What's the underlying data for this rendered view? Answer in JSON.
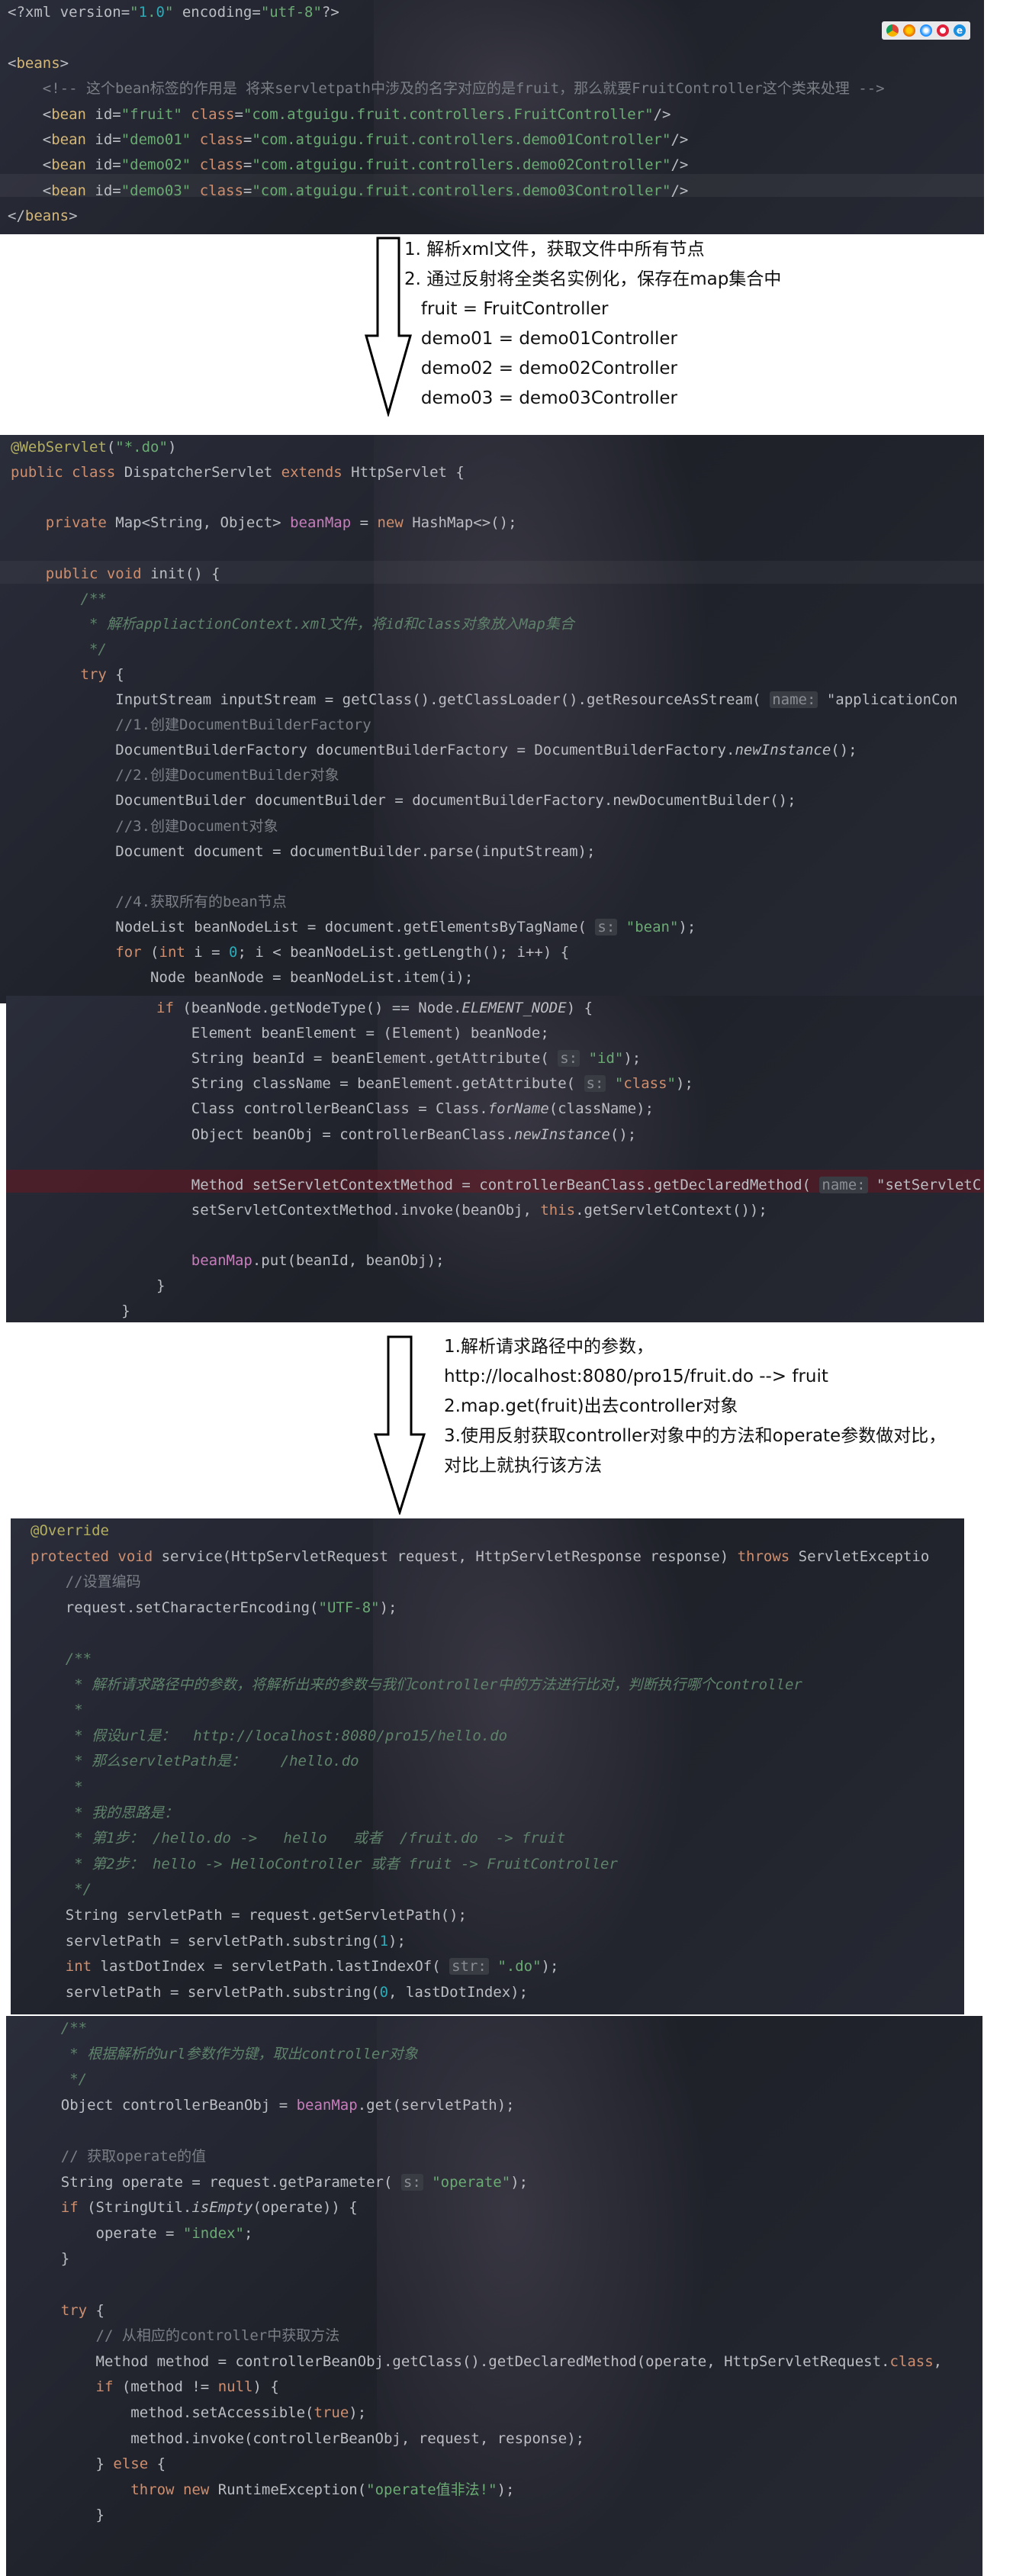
{
  "panel1": {
    "lines": [
      "<?xml version=\"1.0\" encoding=\"utf-8\"?>",
      "",
      "<beans>",
      "    <!-- 这个bean标签的作用是 将来servletpath中涉及的名字对应的是fruit，那么就要FruitController这个类来处理 -->",
      "    <bean id=\"fruit\" class=\"com.atguigu.fruit.controllers.FruitController\"/>",
      "    <bean id=\"demo01\" class=\"com.atguigu.fruit.controllers.demo01Controller\"/>",
      "    <bean id=\"demo02\" class=\"com.atguigu.fruit.controllers.demo02Controller\"/>",
      "    <bean id=\"demo03\" class=\"com.atguigu.fruit.controllers.demo03Controller\"/>",
      "</beans>"
    ]
  },
  "annotation1": [
    "1. 解析xml文件，获取文件中所有节点",
    "2. 通过反射将全类名实例化，保存在map集合中",
    "   fruit = FruitController",
    "   demo01 = demo01Controller",
    "   demo02 = demo02Controller",
    "   demo03 = demo03Controller"
  ],
  "panel2": {
    "lines": [
      "@WebServlet(\"*.do\")",
      "public class DispatcherServlet extends HttpServlet {",
      "",
      "    private Map<String, Object> beanMap = new HashMap<>();",
      "",
      "    public void init() {",
      "        /**",
      "         * 解析appliactionContext.xml文件，将id和class对象放入Map集合",
      "         */",
      "        try {",
      "            InputStream inputStream = getClass().getClassLoader().getResourceAsStream( name: \"applicationCon",
      "            //1.创建DocumentBuilderFactory",
      "            DocumentBuilderFactory documentBuilderFactory = DocumentBuilderFactory.newInstance();",
      "            //2.创建DocumentBuilder对象",
      "            DocumentBuilder documentBuilder = documentBuilderFactory.newDocumentBuilder();",
      "            //3.创建Document对象",
      "            Document document = documentBuilder.parse(inputStream);",
      "",
      "            //4.获取所有的bean节点",
      "            NodeList beanNodeList = document.getElementsByTagName( s: \"bean\");",
      "            for (int i = 0; i < beanNodeList.getLength(); i++) {",
      "                Node beanNode = beanNodeList.item(i);"
    ]
  },
  "panel3": {
    "lines": [
      "                if (beanNode.getNodeType() == Node.ELEMENT_NODE) {",
      "                    Element beanElement = (Element) beanNode;",
      "                    String beanId = beanElement.getAttribute( s: \"id\");",
      "                    String className = beanElement.getAttribute( s: \"class\");",
      "                    Class controllerBeanClass = Class.forName(className);",
      "                    Object beanObj = controllerBeanClass.newInstance();",
      "",
      "                    Method setServletContextMethod = controllerBeanClass.getDeclaredMethod( name: \"setServletC",
      "                    setServletContextMethod.invoke(beanObj, this.getServletContext());",
      "",
      "                    beanMap.put(beanId, beanObj);",
      "                }",
      "            }"
    ]
  },
  "annotation2": [
    "1.解析请求路径中的参数，",
    "http://localhost:8080/pro15/fruit.do --> fruit",
    "2.map.get(fruit)出去controller对象",
    "3.使用反射获取controller对象中的方法和operate参数做对比，",
    "对比上就执行该方法"
  ],
  "panel4": {
    "lines": [
      "@Override",
      "protected void service(HttpServletRequest request, HttpServletResponse response) throws ServletExceptio",
      "    //设置编码",
      "    request.setCharacterEncoding(\"UTF-8\");",
      "",
      "    /**",
      "     * 解析请求路径中的参数，将解析出来的参数与我们controller中的方法进行比对，判断执行哪个controller",
      "     *",
      "     * 假设url是：  http://localhost:8080/pro15/hello.do",
      "     * 那么servletPath是：    /hello.do",
      "     *",
      "     * 我的思路是：",
      "     * 第1步： /hello.do ->   hello   或者  /fruit.do  -> fruit",
      "     * 第2步： hello -> HelloController 或者 fruit -> FruitController",
      "     */",
      "    String servletPath = request.getServletPath();",
      "    servletPath = servletPath.substring(1);",
      "    int lastDotIndex = servletPath.lastIndexOf( str: \".do\");",
      "    servletPath = servletPath.substring(0, lastDotIndex);"
    ]
  },
  "panel5": {
    "lines": [
      "    /**",
      "     * 根据解析的url参数作为键，取出controller对象",
      "     */",
      "    Object controllerBeanObj = beanMap.get(servletPath);",
      "",
      "    // 获取operate的值",
      "    String operate = request.getParameter( s: \"operate\");",
      "    if (StringUtil.isEmpty(operate)) {",
      "        operate = \"index\";",
      "    }",
      "",
      "    try {",
      "        // 从相应的controller中获取方法",
      "        Method method = controllerBeanObj.getClass().getDeclaredMethod(operate, HttpServletRequest.class, ",
      "        if (method != null) {",
      "            method.setAccessible(true);",
      "            method.invoke(controllerBeanObj, request, response);",
      "        } else {",
      "            throw new RuntimeException(\"operate值非法!\");",
      "        }"
    ]
  }
}
